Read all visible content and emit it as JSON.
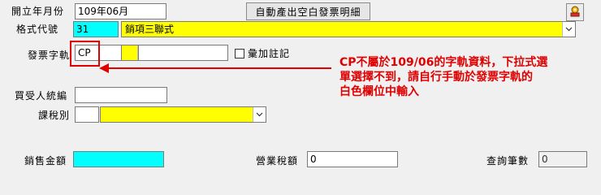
{
  "form": {
    "date_label": "開立年月份",
    "date_value": "109年06月",
    "auto_button": "自動產出空白發票明細",
    "format_label": "格式代號",
    "format_code": "31",
    "format_name": "銷項三聯式",
    "track_label": "發票字軌",
    "track_value": "CP",
    "merge_note_label": "彙加註記",
    "merge_note_checked": false,
    "buyer_id_label": "買受人統編",
    "buyer_id_value": "",
    "tax_type_label": "課稅別",
    "tax_type_code": "",
    "tax_type_name": "",
    "sales_amount_label": "銷售金額",
    "sales_amount_value": "",
    "tax_amount_label": "營業稅額",
    "tax_amount_value": "0",
    "query_count_label": "查詢筆數",
    "query_count_value": "0"
  },
  "annotation": {
    "text_line1": "CP不屬於109/06的字軌資料，下拉式選",
    "text_line2": "單選擇不到，請自行手動於發票字軌的",
    "text_line3": "白色欄位中輸入",
    "color": "#e00000"
  },
  "icons": {
    "dropdown": "chevron-down-icon",
    "tool": "tool-icon"
  }
}
